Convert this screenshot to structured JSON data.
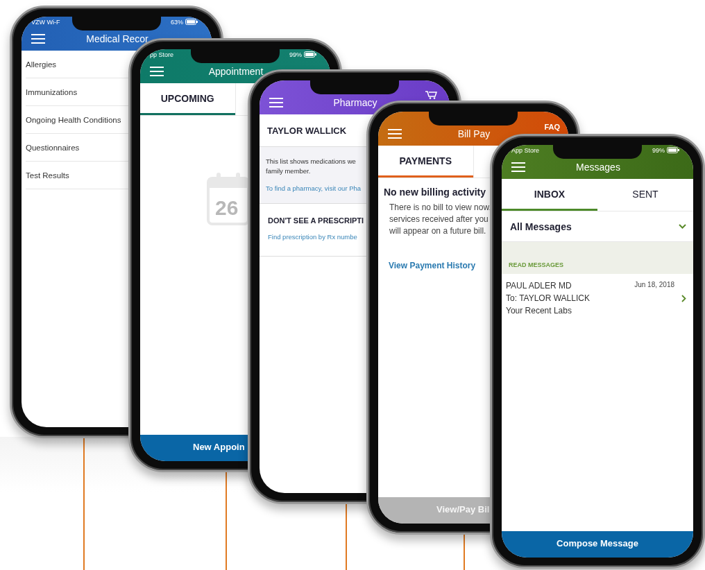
{
  "phones": [
    {
      "kind": "records",
      "status": {
        "carrier": "VZW Wi-F",
        "battery": "63%"
      },
      "title": "Medical Recor",
      "items": [
        "Allergies",
        "Immunizations",
        "Ongoing Health Conditions",
        "Questionnaires",
        "Test Results"
      ]
    },
    {
      "kind": "appointments",
      "status": {
        "carrier": "pp Store",
        "battery": "99%"
      },
      "title": "Appointment",
      "tabs": [
        {
          "label": "UPCOMING",
          "selected": true
        }
      ],
      "calendar_day": "26",
      "button": {
        "label": "New Appoin",
        "disabled": false
      }
    },
    {
      "kind": "pharmacy",
      "title": "Pharmacy",
      "patient": "TAYLOR WALLICK",
      "info_lines": [
        "This list shows medications we",
        "family member."
      ],
      "info_link": "To find a pharmacy, visit our Pha",
      "prompt": "DON'T SEE A PRESCRIPTI",
      "prompt_link": "Find prescription by Rx numbe"
    },
    {
      "kind": "billing",
      "title": "Bill Pay",
      "action": "FAQ",
      "tabs": [
        {
          "label": "PAYMENTS",
          "selected": true
        }
      ],
      "heading": "No new billing activity",
      "body_lines": [
        "There is no bill to view now.",
        "services received after you",
        "will appear on a future bill."
      ],
      "link": "View Payment History",
      "button": {
        "label": "View/Pay Bil",
        "disabled": true
      }
    },
    {
      "kind": "messages",
      "status": {
        "carrier": "App Store",
        "battery": "99%"
      },
      "title": "Messages",
      "tabs": [
        {
          "label": "INBOX",
          "selected": true
        },
        {
          "label": "SENT",
          "selected": false
        }
      ],
      "filter": "All Messages",
      "section": "READ MESSAGES",
      "message": {
        "from": "PAUL ADLER MD",
        "to": "To: TAYLOR WALLICK",
        "subject": "Your Recent Labs",
        "date": "Jun 18, 2018"
      },
      "button": {
        "label": "Compose Message",
        "disabled": false
      }
    }
  ]
}
